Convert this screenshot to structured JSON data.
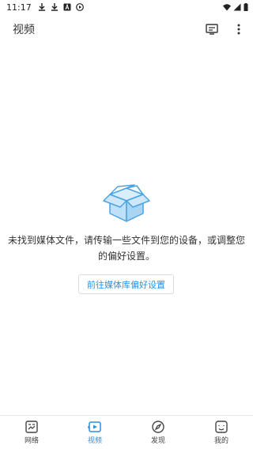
{
  "status_bar": {
    "time": "11:17",
    "left_icons": [
      "download-icon",
      "download-icon",
      "a-badge-icon",
      "play-circle-icon"
    ],
    "right_icons": [
      "wifi-icon",
      "signal-icon",
      "battery-icon"
    ]
  },
  "app_bar": {
    "title": "视频",
    "actions": [
      "cast-screen-icon",
      "more-vert-icon"
    ]
  },
  "empty_state": {
    "icon": "open-box-icon",
    "message": "未找到媒体文件，请传输一些文件到您的设备，或调整您的偏好设置。",
    "button_label": "前往媒体库偏好设置"
  },
  "bottom_nav": {
    "items": [
      {
        "label": "网络",
        "icon": "network-icon"
      },
      {
        "label": "视频",
        "icon": "video-icon"
      },
      {
        "label": "发现",
        "icon": "compass-icon"
      },
      {
        "label": "我的",
        "icon": "profile-icon"
      }
    ],
    "active_index": 1
  },
  "colors": {
    "accent": "#2a8fe0",
    "text": "#333333",
    "box_fill": "#bfe0f7",
    "box_stroke": "#4aa3e6"
  }
}
